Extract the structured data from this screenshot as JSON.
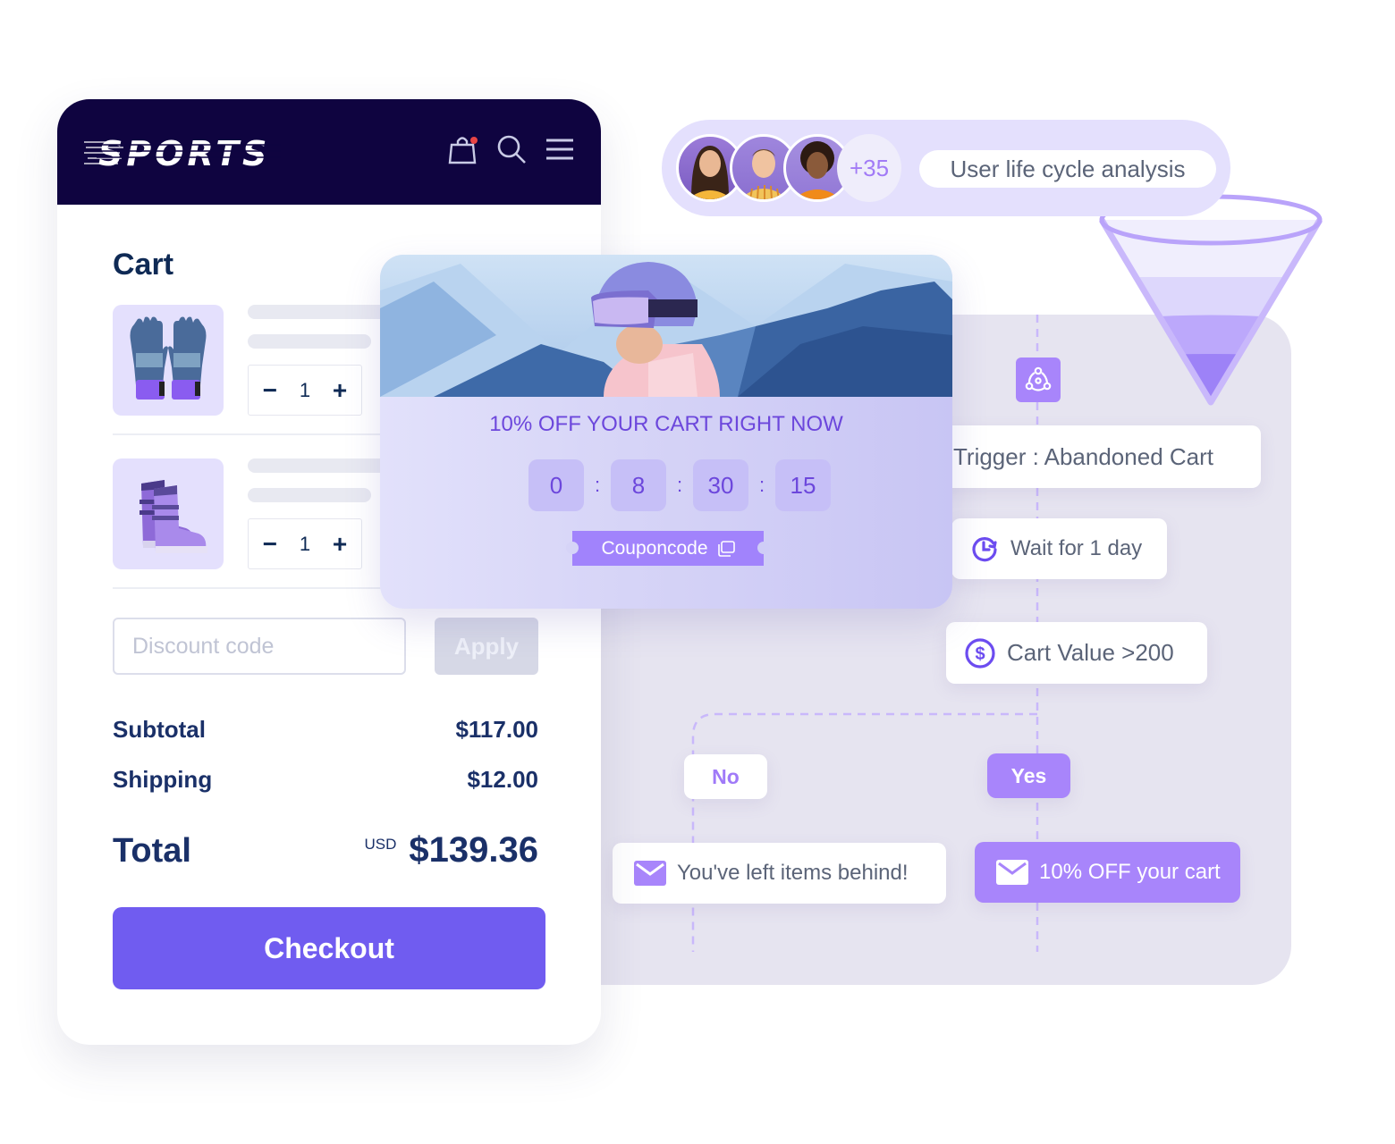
{
  "header": {
    "brand": "SPORTS",
    "cart_icon": "shopping-bag-icon",
    "search_icon": "search-icon",
    "menu_icon": "hamburger-menu-icon",
    "cart_notification": true
  },
  "cart": {
    "title": "Cart",
    "items": [
      {
        "name": "Ski gloves",
        "image": "gloves-image",
        "quantity": "1"
      },
      {
        "name": "Ski boots",
        "image": "boots-image",
        "quantity": "1"
      }
    ],
    "stepper": {
      "minus": "−",
      "plus": "+"
    },
    "discount": {
      "placeholder": "Discount code",
      "value": ""
    },
    "apply_label": "Apply",
    "subtotal_label": "Subtotal",
    "subtotal_value": "$117.00",
    "shipping_label": "Shipping",
    "shipping_value": "$12.00",
    "total_label": "Total",
    "total_currency": "USD",
    "total_value": "$139.36",
    "checkout_label": "Checkout"
  },
  "promo": {
    "image": "skier-mountain-banner",
    "title": "10% OFF YOUR CART RIGHT NOW",
    "timer": [
      "0",
      "8",
      "30",
      "15"
    ],
    "timer_separator": ":",
    "coupon_label": "Couponcode",
    "coupon_icon": "copy-icon"
  },
  "lifecycle": {
    "avatars": [
      "avatar-woman-smiling",
      "avatar-man-striped-shirt",
      "avatar-woman-curly-hair"
    ],
    "extra_count": "+35",
    "label": "User life cycle analysis"
  },
  "flow": {
    "trigger_icon": "workflow-nodes-icon",
    "trigger": "Trigger : Abandoned Cart",
    "wait": "Wait for 1 day",
    "condition": "Cart Value >200",
    "no_label": "No",
    "yes_label": "Yes",
    "no_action": "You've left items behind!",
    "yes_action": "10% OFF your cart"
  },
  "colors": {
    "brand_dark": "#0f0440",
    "primary": "#705cf0",
    "accent_purple": "#a885fb",
    "flow_bg": "#e6e4f0",
    "text_navy": "#1a3068",
    "text_gray": "#5b6478",
    "notification": "#e84545"
  }
}
